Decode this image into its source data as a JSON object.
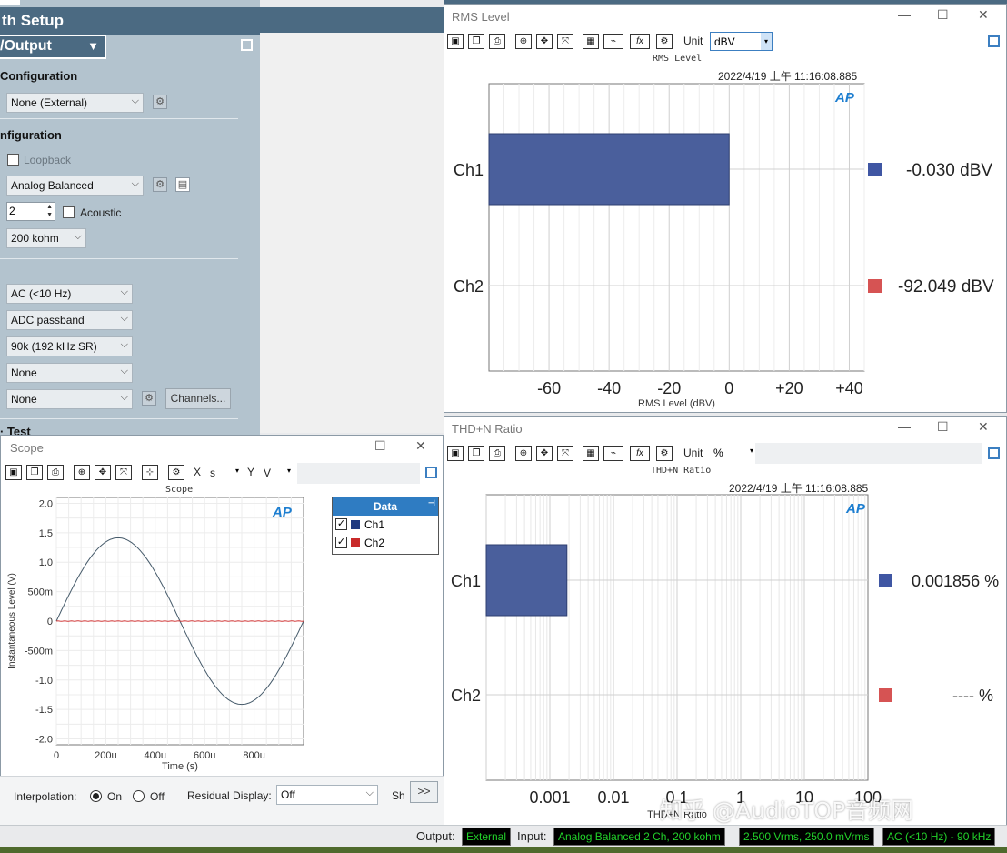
{
  "setup": {
    "title": "th Setup",
    "io_tab": "/Output",
    "config1": "Configuration",
    "config1_select": "None (External)",
    "config2": "nfiguration",
    "loopback": "Loopback",
    "connector_select": "Analog Balanced",
    "channels_value": "2",
    "acoustic": "Acoustic",
    "impedance_select": "200 kohm",
    "coupling_select": "AC (<10 Hz)",
    "filter_select": "ADC passband",
    "bandwidth_select": "90k (192 kHz SR)",
    "none1_select": "None",
    "none2_select": "None",
    "channels_button": "Channels...",
    "partial_section": "· Test"
  },
  "rms": {
    "window_title": "RMS Level",
    "unit_label": "Unit",
    "unit_value": "dBV",
    "chart_title": "RMS Level",
    "timestamp": "2022/4/19 上午 11:16:08.885",
    "logo": "AP",
    "ch1_value": "-0.030  dBV",
    "ch2_value": "-92.049  dBV",
    "ch1_color": "#f26522",
    "bar_color": "#4a5f9c",
    "ch1_marker": "#3f56a3",
    "ch2_marker": "#d65353"
  },
  "thd": {
    "window_title": "THD+N Ratio",
    "unit_label": "Unit",
    "unit_value": "%",
    "chart_title": "THD+N Ratio",
    "timestamp": "2022/4/19 上午 11:16:08.885",
    "logo": "AP",
    "ch1_value": "0.001856 %",
    "ch2_value": "----  %",
    "xlabel_partial": "THD+N Ratio"
  },
  "scope": {
    "window_title": "Scope",
    "x_label": "X",
    "x_unit": "s",
    "y_label": "Y",
    "y_unit": "V",
    "chart_title": "Scope",
    "logo": "AP",
    "legend_title": "Data",
    "legend_ch1": "Ch1",
    "legend_ch2": "Ch2",
    "interp_label": "Interpolation:",
    "on_label": "On",
    "off_label": "Off",
    "residual_label": "Residual Display:",
    "residual_value": "Off",
    "sh_label": "Sh",
    "more_button": ">>"
  },
  "status": {
    "output_label": "Output:",
    "output_value": "External",
    "input_label": "Input:",
    "input_value": "Analog Balanced 2 Ch, 200 kohm",
    "level_value": "2.500 Vrms, 250.0 mVrms",
    "filter_value": "AC (<10 Hz) - 90 kHz"
  },
  "watermark": "知乎 @AudioTOP音频网",
  "chart_data": [
    {
      "type": "bar",
      "title": "RMS Level",
      "xlabel": "RMS Level (dBV)",
      "categories": [
        "Ch1",
        "Ch2"
      ],
      "values": [
        -0.03,
        -92.049
      ],
      "xlim": [
        -80,
        45
      ],
      "xticks": [
        "-60",
        "-40",
        "-20",
        "0",
        "+20",
        "+40"
      ],
      "grid": true
    },
    {
      "type": "bar",
      "title": "THD+N Ratio",
      "xlabel": "THD+N Ratio (%)",
      "x_scale": "log",
      "categories": [
        "Ch1",
        "Ch2"
      ],
      "values": [
        0.001856,
        null
      ],
      "xlim": [
        0.0001,
        100
      ],
      "xticks": [
        "0.001",
        "0.01",
        "0.1",
        "1",
        "10",
        "100"
      ],
      "grid": true
    },
    {
      "type": "line",
      "title": "Scope",
      "xlabel": "Time (s)",
      "ylabel": "Instantaneous Level (V)",
      "xlim": [
        0,
        0.001
      ],
      "ylim": [
        -2.1,
        2.1
      ],
      "xticks": [
        "0",
        "200u",
        "400u",
        "600u",
        "800u"
      ],
      "yticks": [
        "2.0",
        "1.5",
        "1.0",
        "500m",
        "0",
        "-500m",
        "-1.0",
        "-1.5",
        "-2.0"
      ],
      "series": [
        {
          "name": "Ch1",
          "amplitude": 1.414,
          "frequency_hz": 1000,
          "color": "#455a6a"
        },
        {
          "name": "Ch2",
          "amplitude": 0.003,
          "frequency_hz": 1000,
          "color": "#d23c3c"
        }
      ],
      "grid": true
    }
  ]
}
